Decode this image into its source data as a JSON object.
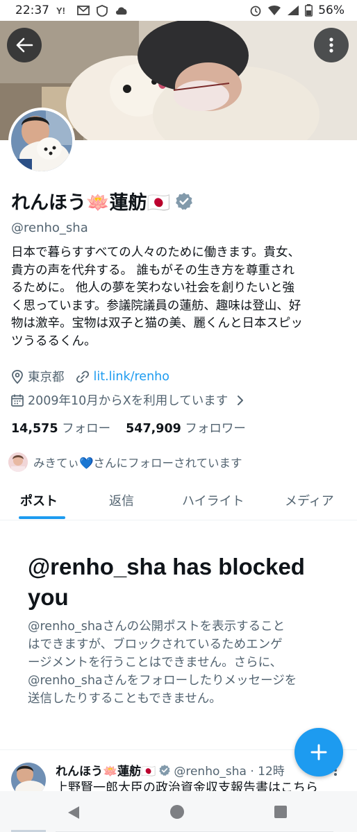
{
  "status_bar": {
    "time": "22:37",
    "battery": "56%"
  },
  "profile": {
    "display_name": "れんほう🪷蓮舫🇯🇵",
    "handle": "@renho_sha",
    "bio": "日本で暮らすすべての人々のために働きます。貴女、\n貴方の声を代弁する。 誰もがその生き方を尊重され\nるために。 他人の夢を笑わない社会を創りたいと強\nく思っています。参議院議員の蓮舫、趣味は登山、好\n物は激辛。宝物は双子と猫の美、麗くんと日本スピッ\nツうるるくん。",
    "location": "東京都",
    "link": "lit.link/renho",
    "joined": "2009年10月からXを利用しています",
    "following_count": "14,575",
    "following_label": "フォロー",
    "followers_count": "547,909",
    "followers_label": "フォロワー",
    "followed_by": "みきてぃ💙さんにフォローされています"
  },
  "tabs": [
    {
      "label": "ポスト",
      "active": true
    },
    {
      "label": "返信",
      "active": false
    },
    {
      "label": "ハイライト",
      "active": false
    },
    {
      "label": "メディア",
      "active": false
    }
  ],
  "blocked": {
    "title": "@renho_sha has blocked you",
    "body": "@renho_shaさんの公開ポストを表示すること\nはできますが、ブロックされているためエンゲ\nージメントを行うことはできません。さらに、\n@renho_shaさんをフォローしたりメッセージを\n送信したりすることもできません。"
  },
  "tweet": {
    "name": "れんほう🪷蓮舫🇯🇵",
    "handle": "@renho_sha · 12時",
    "text": "上野賢一郎大臣の政治資金収支報告書はこちら"
  },
  "colors": {
    "accent": "#1d9bf0",
    "secondary_text": "#536471",
    "verified": "#829aab"
  },
  "icons": {
    "back": "arrow-left-icon",
    "more": "more-vertical-icon",
    "verified": "verified-badge-icon",
    "location": "location-pin-icon",
    "link": "link-icon",
    "calendar": "calendar-icon",
    "chevron": "chevron-right-icon",
    "compose": "plus-icon"
  }
}
